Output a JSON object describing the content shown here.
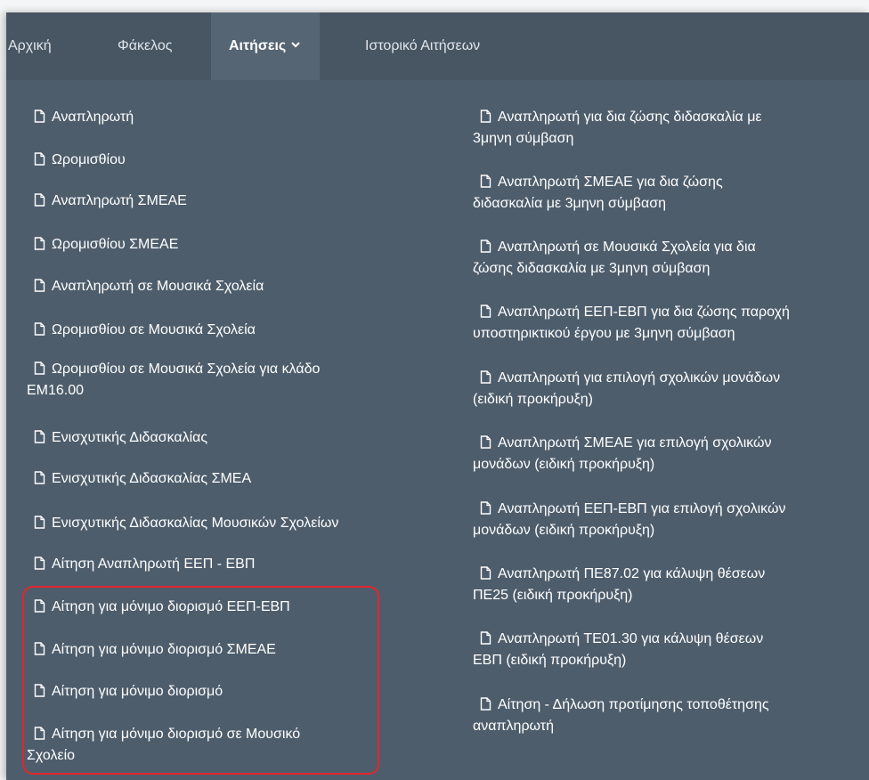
{
  "nav": {
    "items": [
      {
        "label": "Αρχική"
      },
      {
        "label": "Φάκελος"
      },
      {
        "label": "Αιτήσεις"
      },
      {
        "label": "Ιστορικό Αιτήσεων"
      }
    ]
  },
  "menu": {
    "left": [
      {
        "lines": [
          "Αναπληρωτή"
        ]
      },
      {
        "lines": [
          "Ωρομισθίου"
        ]
      },
      {
        "lines": [
          "Αναπληρωτή ΣΜΕΑΕ"
        ]
      },
      {
        "lines": [
          "Ωρομισθίου ΣΜΕΑΕ"
        ]
      },
      {
        "lines": [
          "Αναπληρωτή σε Μουσικά Σχολεία"
        ]
      },
      {
        "lines": [
          "Ωρομισθίου σε Μουσικά Σχολεία"
        ]
      },
      {
        "lines": [
          "Ωρομισθίου σε Μουσικά Σχολεία για κλάδο",
          "ΕΜ16.00"
        ]
      },
      {
        "lines": [
          "Ενισχυτικής Διδασκαλίας"
        ]
      },
      {
        "lines": [
          "Ενισχυτικής Διδασκαλίας ΣΜΕΑ"
        ]
      },
      {
        "lines": [
          "Ενισχυτικής Διδασκαλίας Μουσικών Σχολείων"
        ]
      },
      {
        "lines": [
          "Αίτηση Αναπληρωτή ΕΕΠ - ΕΒΠ"
        ]
      },
      {
        "lines": [
          "Αίτηση για μόνιμο διορισμό ΕΕΠ-ΕΒΠ"
        ]
      },
      {
        "lines": [
          "Αίτηση για μόνιμο διορισμό ΣΜΕΑΕ"
        ]
      },
      {
        "lines": [
          "Αίτηση για μόνιμο διορισμό"
        ]
      },
      {
        "lines": [
          "Αίτηση για μόνιμο διορισμό σε Μουσικό",
          "Σχολείο"
        ]
      }
    ],
    "right": [
      {
        "lines": [
          "Αναπληρωτή για δια ζώσης διδασκαλία με",
          "3μηνη σύμβαση"
        ]
      },
      {
        "lines": [
          "Αναπληρωτή ΣΜΕΑΕ για δια ζώσης",
          "διδασκαλία με 3μηνη σύμβαση"
        ]
      },
      {
        "lines": [
          "Αναπληρωτή σε Μουσικά Σχολεία για δια",
          "ζώσης διδασκαλία με 3μηνη σύμβαση"
        ]
      },
      {
        "lines": [
          "Αναπληρωτή ΕΕΠ-ΕΒΠ για δια ζώσης παροχή",
          "υποστηρικτικού έργου με 3μηνη σύμβαση"
        ]
      },
      {
        "lines": [
          "Αναπληρωτή για επιλογή σχολικών μονάδων",
          "(ειδική προκήρυξη)"
        ]
      },
      {
        "lines": [
          "Αναπληρωτή ΣΜΕΑΕ για επιλογή σχολικών",
          "μονάδων (ειδική προκήρυξη)"
        ]
      },
      {
        "lines": [
          "Αναπληρωτή ΕΕΠ-ΕΒΠ για επιλογή σχολικών",
          "μονάδων (ειδική προκήρυξη)"
        ]
      },
      {
        "lines": [
          "Αναπληρωτή ΠΕ87.02 για κάλυψη θέσεων",
          "ΠΕ25 (ειδική προκήρυξη)"
        ]
      },
      {
        "lines": [
          "Αναπληρωτή ΤΕ01.30 για κάλυψη θέσεων",
          "ΕΒΠ (ειδική προκήρυξη)"
        ]
      },
      {
        "lines": [
          "Αίτηση - Δήλωση προτίμησης τοποθέτησης",
          "αναπληρωτή"
        ]
      }
    ]
  },
  "icons": {
    "menu_item": "file-icon",
    "dropdown": "chevron-down-icon"
  },
  "colors": {
    "navbar": "#485563",
    "panel": "#4e5d6c",
    "active_tab": "#566574",
    "highlight": "#e3262e",
    "text": "#ffffff"
  }
}
